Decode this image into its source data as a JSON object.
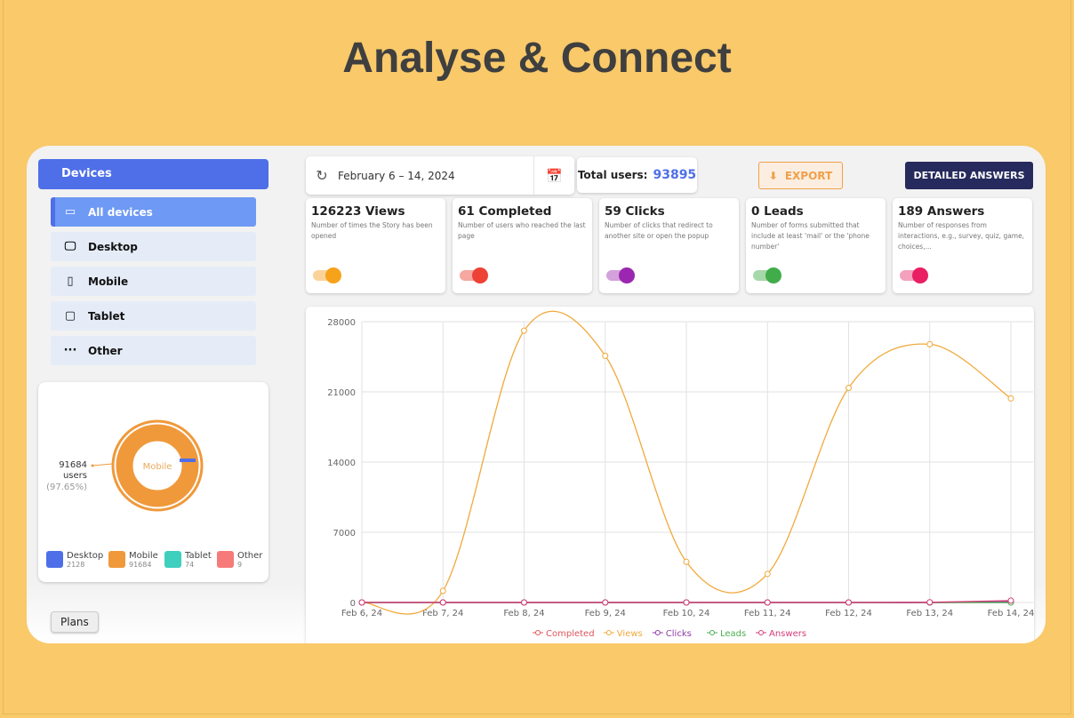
{
  "title": "Analyse & Connect",
  "sidebar": {
    "header": "Devices",
    "items": [
      {
        "label": "All devices",
        "icon": "devices-icon",
        "active": true
      },
      {
        "label": "Desktop",
        "icon": "desktop-icon"
      },
      {
        "label": "Mobile",
        "icon": "mobile-icon"
      },
      {
        "label": "Tablet",
        "icon": "tablet-icon"
      },
      {
        "label": "Other",
        "icon": "more-icon"
      }
    ]
  },
  "donut": {
    "center_label": "Mobile",
    "callout_value": "91684",
    "callout_unit": "users",
    "callout_pct": "(97.65%)",
    "legend": [
      {
        "label": "Desktop",
        "value": "2128",
        "color": "#4f6fe8"
      },
      {
        "label": "Mobile",
        "value": "91684",
        "color": "#f0993b"
      },
      {
        "label": "Tablet",
        "value": "74",
        "color": "#3fcfbf"
      },
      {
        "label": "Other",
        "value": "9",
        "color": "#f77a7a"
      }
    ]
  },
  "plans_tooltip": "Plans",
  "toolbar": {
    "date_range": "February 6 – 14, 2024",
    "total_label": "Total users:",
    "total_value": "93895",
    "export_label": "EXPORT",
    "detailed_label": "DETAILED ANSWERS"
  },
  "metrics": [
    {
      "title": "126223 Views",
      "desc": "Number of times the Story has been opened",
      "color": "#f7a21b",
      "track": "#fbd39a"
    },
    {
      "title": "61 Completed",
      "desc": "Number of users who reached the last page",
      "color": "#ee4235",
      "track": "#f5a7a0"
    },
    {
      "title": "59 Clicks",
      "desc": "Number of clicks that redirect to another site or open the popup",
      "color": "#9b27b0",
      "track": "#d3a1dc"
    },
    {
      "title": "0 Leads",
      "desc": "Number of forms submitted that include at least 'mail' or the 'phone number'",
      "color": "#41ad4a",
      "track": "#a7d8a9"
    },
    {
      "title": "189 Answers",
      "desc": "Number of responses from interactions, e.g., survey, quiz, game, choices,...",
      "color": "#e91e63",
      "track": "#f4a1bd"
    }
  ],
  "chart_data": {
    "type": "line",
    "x": [
      "Feb 6, 24",
      "Feb 7, 24",
      "Feb 8, 24",
      "Feb 9, 24",
      "Feb 10, 24",
      "Feb 11, 24",
      "Feb 12, 24",
      "Feb 13, 24",
      "Feb 14, 24"
    ],
    "ylim": [
      0,
      28000
    ],
    "yticks": [
      0,
      7000,
      14000,
      21000,
      28000
    ],
    "grid": true,
    "legend_placement": "bottom",
    "series": [
      {
        "name": "Completed",
        "color": "#e0555a",
        "values": [
          0,
          0,
          0,
          0,
          0,
          0,
          0,
          0,
          61
        ]
      },
      {
        "name": "Views",
        "color": "#f0a93b",
        "values": [
          0,
          1150,
          27100,
          24600,
          4050,
          2850,
          21400,
          25750,
          20350
        ]
      },
      {
        "name": "Clicks",
        "color": "#8e3aa8",
        "values": [
          0,
          0,
          0,
          0,
          0,
          0,
          0,
          0,
          59
        ]
      },
      {
        "name": "Leads",
        "color": "#4caf50",
        "values": [
          0,
          0,
          0,
          0,
          0,
          0,
          0,
          0,
          0
        ]
      },
      {
        "name": "Answers",
        "color": "#d63a7a",
        "values": [
          0,
          0,
          0,
          0,
          0,
          0,
          0,
          20,
          189
        ]
      }
    ]
  }
}
